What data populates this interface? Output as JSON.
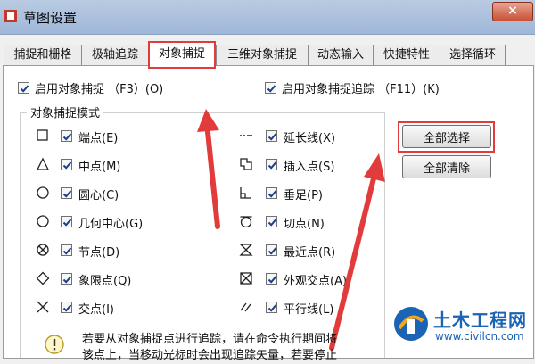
{
  "window": {
    "title": "草图设置",
    "close": "×"
  },
  "tabs": [
    {
      "label": "捕捉和栅格"
    },
    {
      "label": "极轴追踪"
    },
    {
      "label": "对象捕捉",
      "active": true
    },
    {
      "label": "三维对象捕捉"
    },
    {
      "label": "动态输入"
    },
    {
      "label": "快捷特性"
    },
    {
      "label": "选择循环"
    }
  ],
  "toggles": {
    "snap_on": {
      "label": "启用对象捕捉 （F3）(O)",
      "checked": true
    },
    "track_on": {
      "label": "启用对象捕捉追踪 （F11）(K)",
      "checked": true
    }
  },
  "group_title": "对象捕捉模式",
  "modes_left": [
    {
      "label": "端点(E)",
      "icon": "square-icon",
      "checked": true
    },
    {
      "label": "中点(M)",
      "icon": "triangle-icon",
      "checked": true
    },
    {
      "label": "圆心(C)",
      "icon": "circle-icon",
      "checked": true
    },
    {
      "label": "几何中心(G)",
      "icon": "circle-icon",
      "checked": true
    },
    {
      "label": "节点(D)",
      "icon": "node-icon",
      "checked": true
    },
    {
      "label": "象限点(Q)",
      "icon": "diamond-icon",
      "checked": true
    },
    {
      "label": "交点(I)",
      "icon": "cross-icon",
      "checked": true
    }
  ],
  "modes_right": [
    {
      "label": "延长线(X)",
      "icon": "extension-icon",
      "checked": true
    },
    {
      "label": "插入点(S)",
      "icon": "insert-icon",
      "checked": true
    },
    {
      "label": "垂足(P)",
      "icon": "perpendicular-icon",
      "checked": true
    },
    {
      "label": "切点(N)",
      "icon": "tangent-icon",
      "checked": true
    },
    {
      "label": "最近点(R)",
      "icon": "nearest-icon",
      "checked": true
    },
    {
      "label": "外观交点(A)",
      "icon": "apparent-intersection-icon",
      "checked": true
    },
    {
      "label": "平行线(L)",
      "icon": "parallel-icon",
      "checked": true
    }
  ],
  "buttons": {
    "select_all": "全部选择",
    "clear_all": "全部清除"
  },
  "notice": {
    "line1": "若要从对象捕捉点进行追踪，请在命令执行期间将",
    "line2": "该点上，当移动光标时会出现追踪矢量，若要停止"
  },
  "watermark": {
    "name": "土木工程网",
    "url": "www.civilcn.com"
  },
  "colors": {
    "highlight": "#e23b3b",
    "title_bar": "#b9cbe3",
    "watermark": "#1b63b4"
  }
}
